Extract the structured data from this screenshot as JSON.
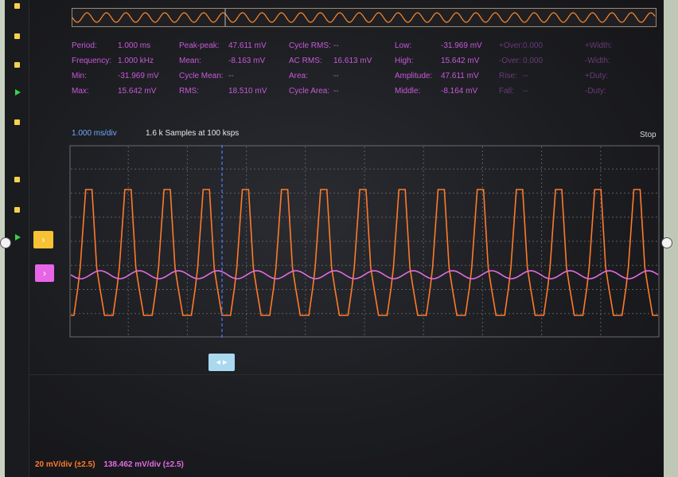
{
  "measurements": {
    "col1": [
      {
        "label": "Period:",
        "value": "1.000 ms"
      },
      {
        "label": "Frequency:",
        "value": "1.000 kHz"
      },
      {
        "label": "Min:",
        "value": "-31.969 mV"
      },
      {
        "label": "Max:",
        "value": "15.642 mV"
      }
    ],
    "col2": [
      {
        "label": "Peak-peak:",
        "value": "47.611 mV"
      },
      {
        "label": "Mean:",
        "value": "-8.163 mV"
      },
      {
        "label": "Cycle Mean:",
        "value": "--"
      },
      {
        "label": "RMS:",
        "value": "18.510 mV"
      }
    ],
    "col3": [
      {
        "label": "Cycle RMS:",
        "value": "--"
      },
      {
        "label": "AC RMS:",
        "value": "16.613 mV"
      },
      {
        "label": "Area:",
        "value": "--"
      },
      {
        "label": "Cycle Area:",
        "value": "--"
      }
    ],
    "col4": [
      {
        "label": "Low:",
        "value": "-31.969 mV"
      },
      {
        "label": "High:",
        "value": "15.642 mV"
      },
      {
        "label": "Amplitude:",
        "value": "47.611 mV"
      },
      {
        "label": "Middle:",
        "value": "-8.164 mV"
      }
    ],
    "col5": [
      {
        "label": "+Over:",
        "value": "0.000"
      },
      {
        "label": "-Over:",
        "value": "0.000"
      },
      {
        "label": "Rise:",
        "value": "--"
      },
      {
        "label": "Fall:",
        "value": "--"
      }
    ],
    "col6": [
      {
        "label": "+Width:",
        "value": ""
      },
      {
        "label": "-Width:",
        "value": ""
      },
      {
        "label": "+Duty:",
        "value": ""
      },
      {
        "label": "-Duty:",
        "value": ""
      }
    ]
  },
  "acquisition": {
    "timebase": "1.000 ms/div",
    "samples": "1.6 k Samples at 100 ksps",
    "run_state": "Stop"
  },
  "channels": {
    "ch1": {
      "marker": "›",
      "scale": "20 mV/div (±2.5)",
      "color": "#ff7a2a"
    },
    "ch2": {
      "marker": "›",
      "scale": "138.462 mV/div (±2.5)",
      "color": "#e26be2"
    }
  },
  "trigger": {
    "icon": "trigger-position-icon",
    "glyph": "◂ ▸"
  },
  "chart_data": {
    "type": "line",
    "series": [
      {
        "channel": "ch1",
        "shape": "trapezoid",
        "cycles": 15,
        "high_mV": 15.642,
        "low_mV": -31.969,
        "color": "#ff7a2a"
      },
      {
        "channel": "ch2",
        "shape": "sine",
        "cycles": 15,
        "color": "#e26be2"
      }
    ],
    "grid": true,
    "xdivs": 10,
    "ydivs": 8
  }
}
